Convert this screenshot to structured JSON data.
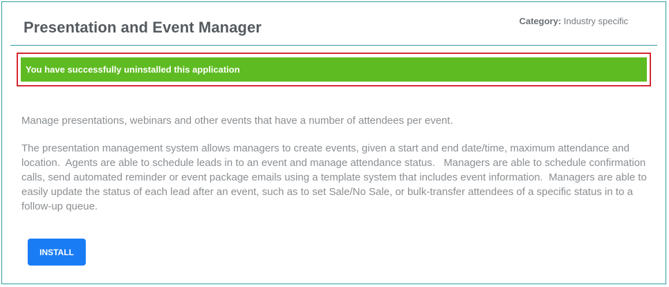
{
  "app": {
    "title": "Presentation and Event Manager",
    "category_label": "Category:",
    "category_value": "Industry specific"
  },
  "alert": {
    "message": "You have successfully uninstalled this application",
    "color": "#5fbb22"
  },
  "description": {
    "short": "Manage presentations, webinars and other events that have a number of attendees per event.",
    "long": "The presentation management system allows managers to create events, given a start and end date/time, maximum attendance and location.  Agents are able to schedule leads in to an event and manage attendance status.   Managers are able to schedule confirmation calls, send automated reminder or event package emails using a template system that includes event information.  Managers are able to easily update the status of each lead after an event, such as to set Sale/No Sale, or bulk-transfer attendees of a specific status in to a follow-up queue."
  },
  "actions": {
    "install_label": "INSTALL",
    "install_color": "#1a7cf5"
  }
}
